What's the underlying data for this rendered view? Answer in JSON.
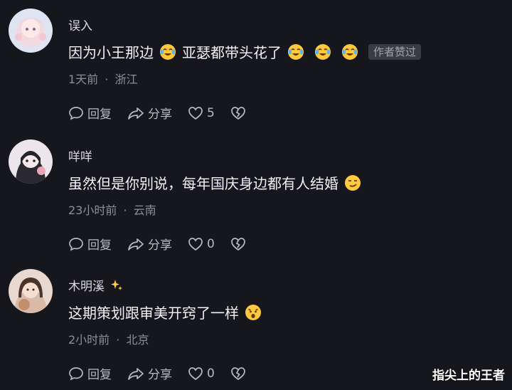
{
  "comments": [
    {
      "username": "误入",
      "text": "因为小王那边",
      "text_part2": "亚瑟都带头花了",
      "emojis": [
        "crying-laughing-emoji",
        "crying-laughing-emoji",
        "crying-laughing-emoji",
        "crying-laughing-emoji"
      ],
      "badge": "作者赞过",
      "time": "1天前",
      "location": "浙江",
      "reply_label": "回复",
      "share_label": "分享",
      "likes": "5"
    },
    {
      "username": "咩咩",
      "text": "虽然但是你别说，每年国庆身边都有人结婚",
      "emojis": [
        "smirk-emoji"
      ],
      "time": "23小时前",
      "location": "云南",
      "reply_label": "回复",
      "share_label": "分享",
      "likes": "0"
    },
    {
      "username": "木明溪",
      "username_icon": "sparkles-icon",
      "text": "这期策划跟审美开窍了一样",
      "emojis": [
        "shocked-emoji"
      ],
      "time": "2小时前",
      "location": "北京",
      "reply_label": "回复",
      "share_label": "分享",
      "likes": "0"
    }
  ],
  "separator": "·",
  "watermark": "指尖上的王者",
  "colors": {
    "background": "#16171d",
    "text_primary": "#f1f1f5",
    "text_secondary": "#8d8e98",
    "badge_bg": "#3a3b44"
  }
}
